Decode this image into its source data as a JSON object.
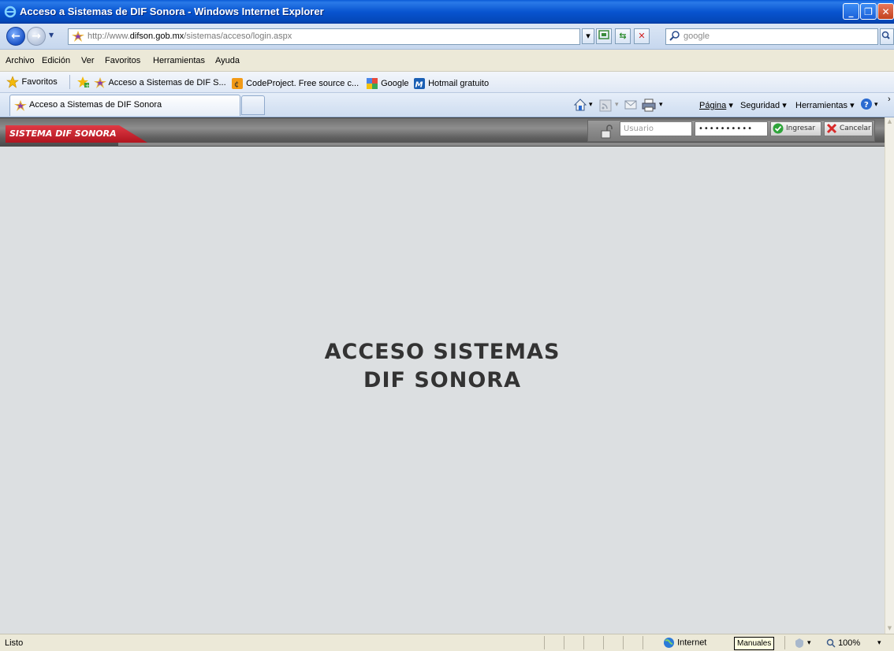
{
  "window": {
    "title": "Acceso a Sistemas de DIF Sonora - Windows Internet Explorer"
  },
  "address_bar": {
    "url_prefix": "http://www.",
    "url_host": "difson.gob.mx",
    "url_path": "/sistemas/acceso/login.aspx",
    "search_placeholder": "google"
  },
  "menu": [
    "Archivo",
    "Edición",
    "Ver",
    "Favoritos",
    "Herramientas",
    "Ayuda"
  ],
  "favorites_bar": {
    "favorites_label": "Favoritos",
    "links": [
      "Acceso a Sistemas de DIF S...",
      "CodeProject. Free source c...",
      "Google",
      "Hotmail gratuito"
    ]
  },
  "tab": {
    "title": "Acceso a Sistemas de DIF Sonora"
  },
  "command_bar": {
    "page": "Página",
    "security": "Seguridad",
    "tools": "Herramientas"
  },
  "site": {
    "brand": "SISTEMA DIF SONORA",
    "username_placeholder": "Usuario",
    "password_mask": "••••••••••",
    "login_button": "Ingresar",
    "cancel_button": "Cancelar",
    "heading_line1": "ACCESO SISTEMAS",
    "heading_line2": "DIF SONORA"
  },
  "status_bar": {
    "status": "Listo",
    "zone": "Internet",
    "tooltip": "Manuales",
    "zoom": "100%"
  },
  "colors": {
    "brand_red": "#c41f2a",
    "titlebar_blue": "#0854d0",
    "page_bg": "#dcdfe1"
  }
}
